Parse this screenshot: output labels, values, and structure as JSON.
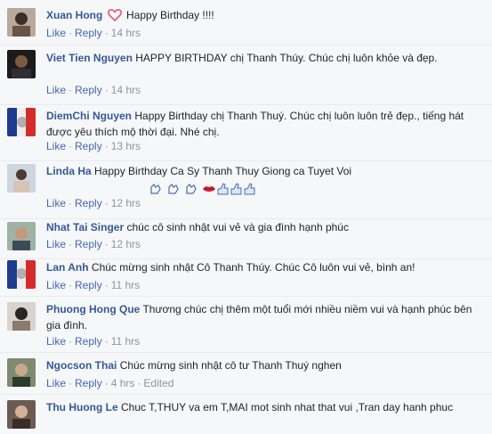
{
  "actions": {
    "like": "Like",
    "reply": "Reply",
    "separator": "·"
  },
  "comments": [
    {
      "author": "Xuan Hong",
      "text": "Happy Birthday !!!!",
      "time": "14 hrs",
      "avatar": "person-avatar"
    },
    {
      "author": "Viet Tien Nguyen",
      "text": "HAPPY BIRTHDAY chị Thanh Thúy. Chúc chị luôn khỏe và đẹp.",
      "time": "14 hrs",
      "avatar": "person-avatar"
    },
    {
      "author": "DiemChi Nguyen",
      "text": "Happy Birthday chị Thanh Thuý. Chúc chị luôn luôn trẻ đẹp., tiếng hát được yêu thích mộ thời đại. Nhé chị.",
      "time": "13 hrs",
      "avatar": "french-flag-avatar"
    },
    {
      "author": "Linda Ha",
      "text": "Happy Birthday Ca Sy Thanh Thuy Giong ca Tuyet Voi",
      "time": "12 hrs",
      "avatar": "person-avatar"
    },
    {
      "author": "Nhat Tai Singer",
      "text": "chúc cô sinh nhật vui vẻ và gia đình hạnh phúc",
      "time": "12 hrs",
      "avatar": "person-avatar"
    },
    {
      "author": "Lan Anh",
      "text": "Chúc mừng sinh nhật Cô Thanh Thúy. Chúc Cô luôn vui vẻ, bình an!",
      "time": "11 hrs",
      "avatar": "french-flag-avatar"
    },
    {
      "author": "Phuong Hong Que",
      "text": "Thương chúc chị thêm một tuổi mới nhiều niềm vui và hạnh phúc bên gia đình.",
      "time": "11 hrs",
      "avatar": "person-avatar"
    },
    {
      "author": "Ngocson Thai",
      "text": "Chúc mừng sinh nhật cô tư Thanh Thuý nghen",
      "time": "4 hrs",
      "edited": "Edited",
      "avatar": "person-avatar"
    },
    {
      "author": "Thu Huong Le",
      "text": "Chuc T,THUY va em T,MAI mot sinh nhat that vui ,Tran day hanh phuc",
      "time": "",
      "avatar": "person-avatar"
    }
  ],
  "colors": {
    "link": "#365899",
    "action": "#4267b2",
    "meta": "#90949c",
    "heart": "#e9566f"
  }
}
